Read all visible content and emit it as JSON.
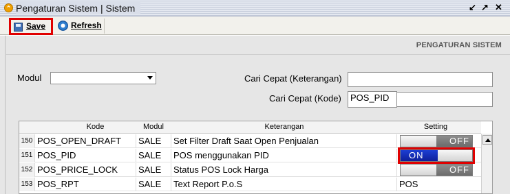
{
  "window": {
    "title": "Pengaturan Sistem | Sistem",
    "buttons": [
      "restore-icon",
      "maximize-icon",
      "close-icon"
    ]
  },
  "toolbar": {
    "save_label": "Save",
    "refresh_label": "Refresh"
  },
  "section_title": "PENGATURAN SISTEM",
  "form": {
    "modul_label": "Modul",
    "modul_value": "",
    "cari_keterangan_label": "Cari Cepat (Keterangan)",
    "cari_keterangan_value": "",
    "cari_kode_label": "Cari Cepat (Kode)",
    "cari_kode_value": "POS_PID"
  },
  "table": {
    "columns": [
      "Kode",
      "Modul",
      "Keterangan",
      "Setting"
    ],
    "rows": [
      {
        "num": "150",
        "kode": "POS_OPEN_DRAFT",
        "modul": "SALE",
        "keterangan": "Set Filter Draft Saat Open Penjualan",
        "setting": "OFF"
      },
      {
        "num": "151",
        "kode": "POS_PID",
        "modul": "SALE",
        "keterangan": "POS menggunakan PID",
        "setting": "ON"
      },
      {
        "num": "152",
        "kode": "POS_PRICE_LOCK",
        "modul": "SALE",
        "keterangan": "Status POS Lock Harga",
        "setting": "OFF"
      },
      {
        "num": "153",
        "kode": "POS_RPT",
        "modul": "SALE",
        "keterangan": "Text Report P.o.S",
        "setting": "POS"
      }
    ]
  },
  "colors": {
    "highlight": "#e00000",
    "toggle_on": "#1c3fd3",
    "toggle_off": "#7a7a7a"
  }
}
